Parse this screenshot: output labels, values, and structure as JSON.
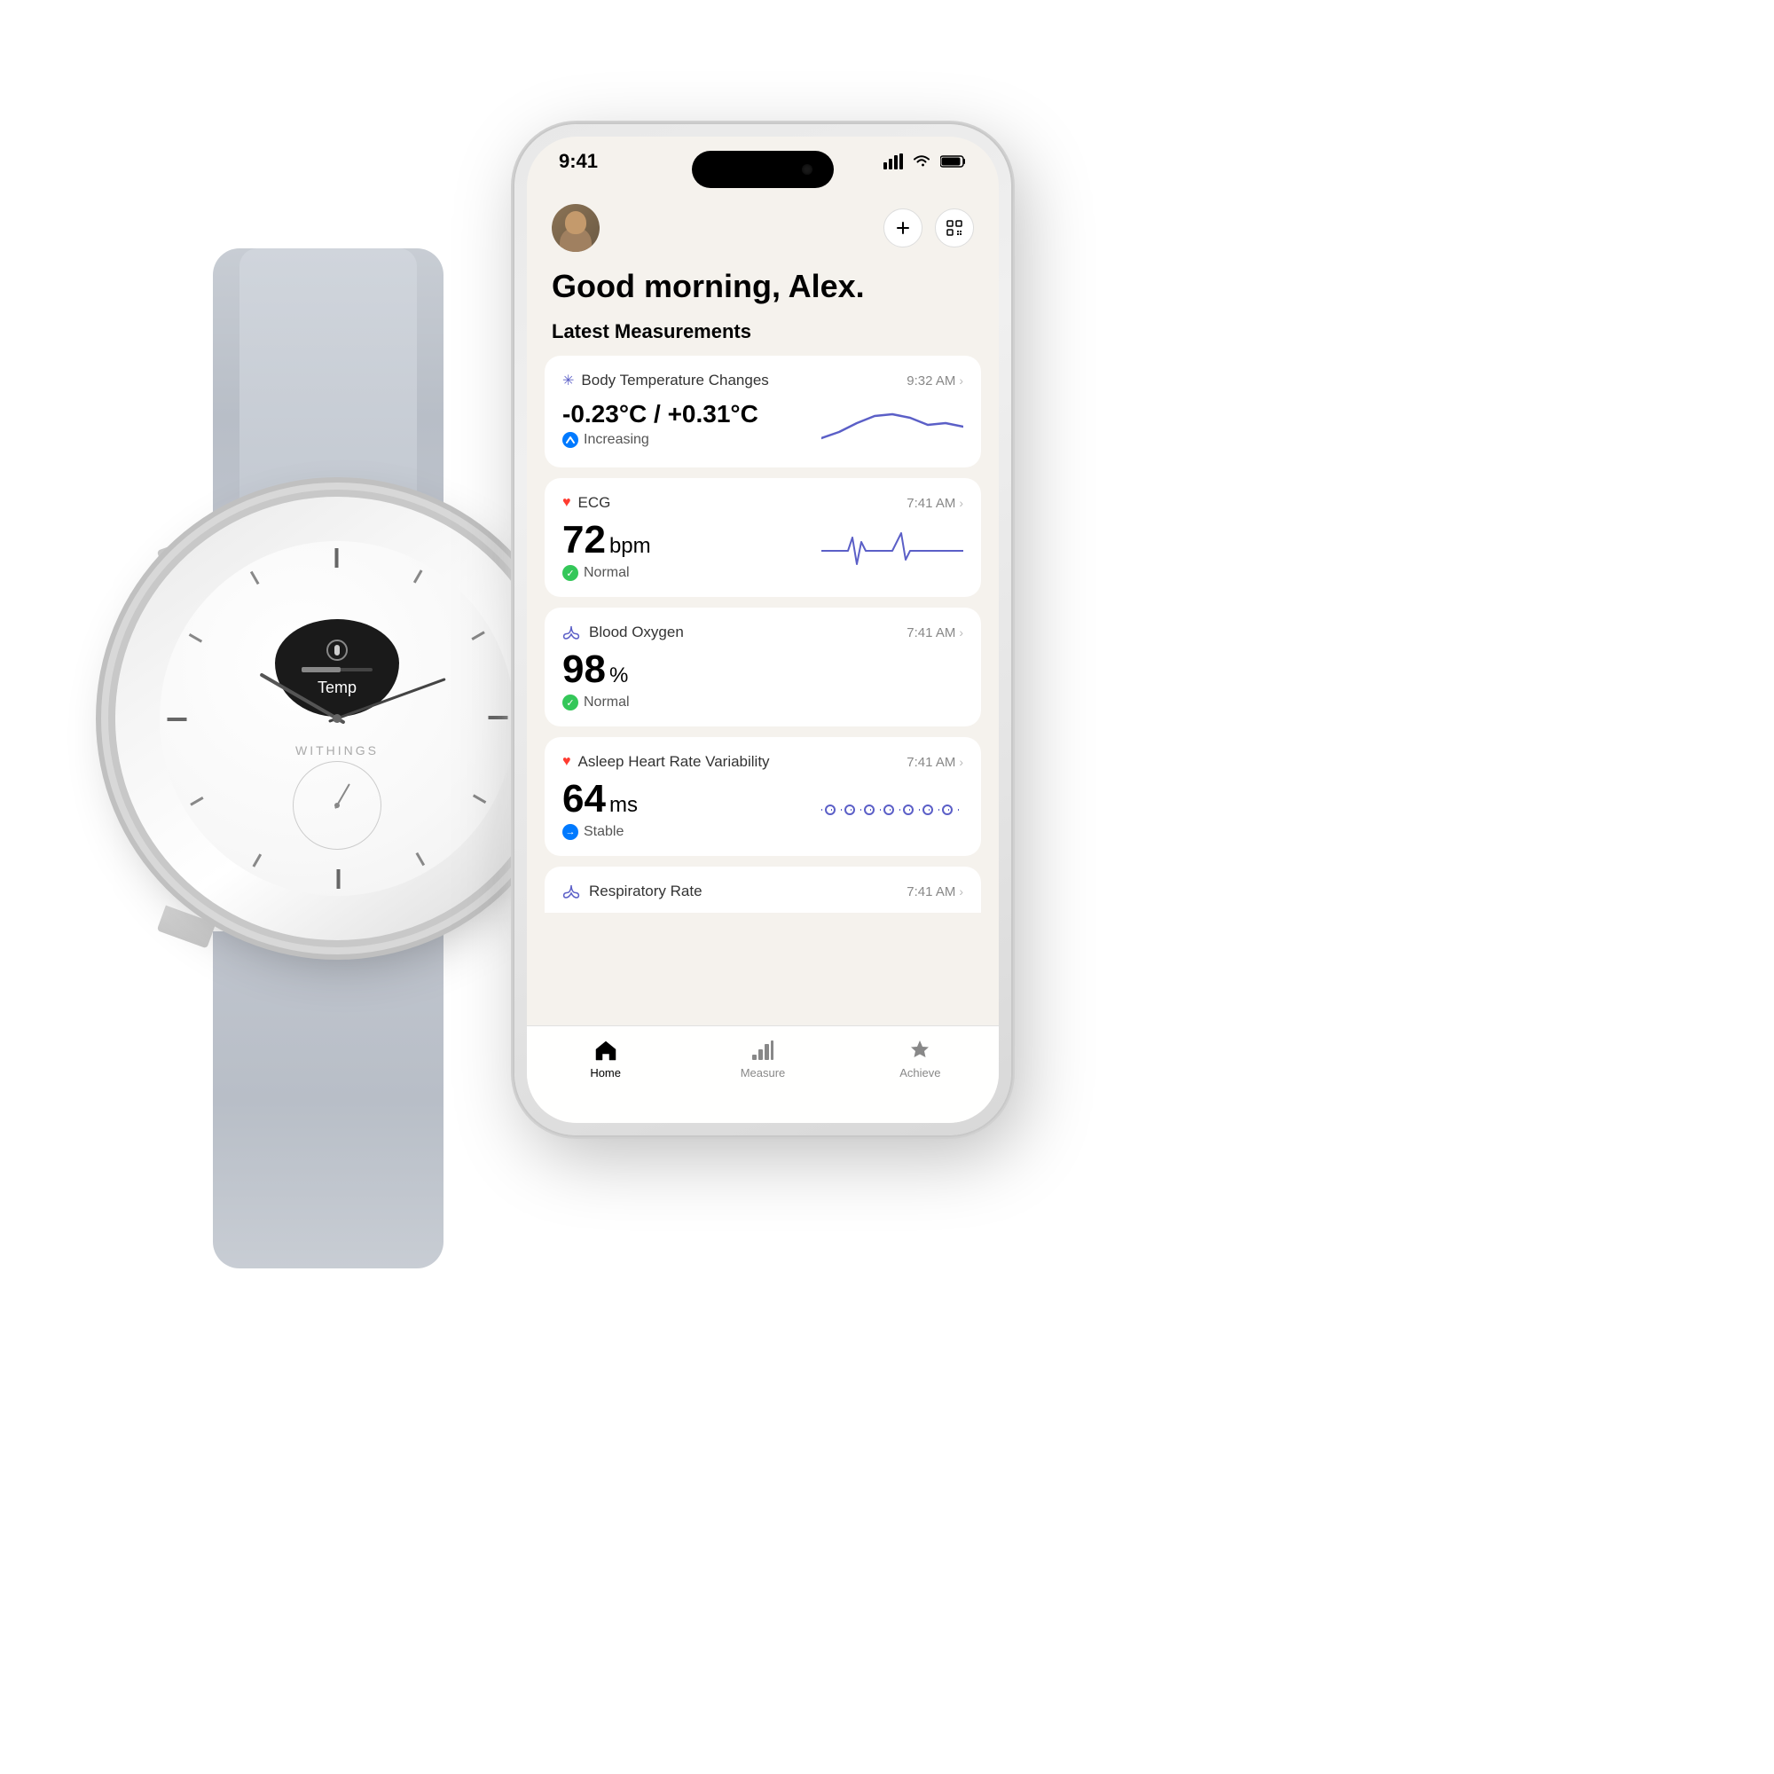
{
  "watch": {
    "brand": "WITHINGS",
    "temp_label": "Temp"
  },
  "phone": {
    "status_bar": {
      "time": "9:41"
    },
    "header": {
      "greeting": "Good morning, Alex."
    },
    "section_title": "Latest Measurements",
    "measurements": [
      {
        "id": "body-temp",
        "icon": "✳",
        "icon_color": "#5b5fc7",
        "title": "Body Temperature Changes",
        "time": "9:32 AM",
        "value": "-0.23°C / +0.31°C",
        "value_type": "text",
        "status_type": "trend",
        "status_icon": "trend-up",
        "status_text": "Increasing",
        "has_sparkline": true,
        "sparkline_type": "temp"
      },
      {
        "id": "ecg",
        "icon": "♥",
        "icon_color": "#ff3b30",
        "title": "ECG",
        "time": "7:41 AM",
        "value": "72",
        "unit": "bpm",
        "status_check": "green",
        "status_text": "Normal",
        "has_sparkline": true,
        "sparkline_type": "ecg"
      },
      {
        "id": "blood-oxygen",
        "icon": "🫁",
        "icon_color": "#5b5fc7",
        "title": "Blood Oxygen",
        "time": "7:41 AM",
        "value": "98",
        "unit": "%",
        "status_check": "green",
        "status_text": "Normal",
        "has_sparkline": false
      },
      {
        "id": "hrv",
        "icon": "♥",
        "icon_color": "#ff3b30",
        "title": "Asleep Heart Rate Variability",
        "time": "7:41 AM",
        "value": "64",
        "unit": "ms",
        "status_check": "blue",
        "status_text": "Stable",
        "has_sparkline": true,
        "sparkline_type": "hrv"
      },
      {
        "id": "respiratory",
        "icon": "🫁",
        "icon_color": "#5b5fc7",
        "title": "Respiratory Rate",
        "time": "7:41 AM",
        "value": "",
        "unit": "",
        "partial": true
      }
    ],
    "tab_bar": {
      "tabs": [
        {
          "id": "home",
          "label": "Home",
          "icon": "⌂",
          "active": true
        },
        {
          "id": "measure",
          "label": "Measure",
          "icon": "📊",
          "active": false
        },
        {
          "id": "achieve",
          "label": "Achieve",
          "icon": "★",
          "active": false
        }
      ]
    }
  }
}
